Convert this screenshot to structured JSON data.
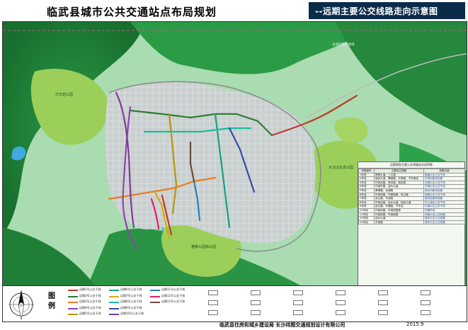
{
  "header": {
    "title": "临武县城市公共交通站点布局规划",
    "subtitle": "--远期主要公交线路走向示意图"
  },
  "map": {
    "labels": {
      "park_west": "万华岩公园",
      "park_east": "大汉山生态公园",
      "park_south": "舂陵公园南公园",
      "road_north": "汝城高速连接线"
    },
    "colors": {
      "forest": "#1f8f3a",
      "park": "#9ccf5a",
      "urban": "#cfd3d3",
      "water": "#3fa9e0"
    }
  },
  "table": {
    "title": "远期规划主要公交线路走向说明表",
    "headers": [
      "线路编号",
      "主要经过道路",
      "线路功能"
    ],
    "rows": [
      {
        "id": "1号线",
        "roads": "舜德大道、三义路",
        "function": "城南片区公交干线"
      },
      {
        "id": "2号线",
        "roads": "临武大道、舜德路、东城路、汽车南站",
        "function": "东西向客流走廊"
      },
      {
        "id": "3号线",
        "roads": "环城北路、滨河路、新区路",
        "function": "北部片区公交干线"
      },
      {
        "id": "4号线",
        "roads": "环城东路、武水大道",
        "function": "东部片区公交干线"
      },
      {
        "id": "5号线",
        "roads": "舜德路、汝城路",
        "function": "南北向客流走廊"
      },
      {
        "id": "6号线",
        "roads": "环城西路、环城南路、官山路",
        "function": "西部片区公交干线"
      },
      {
        "id": "7号线",
        "roads": "官山路、车站路",
        "function": "客运站接驳线路"
      },
      {
        "id": "8号线",
        "roads": "环城北路、武水大道、临武大道",
        "function": "中心城区公交干线"
      },
      {
        "id": "9号线",
        "roads": "官山路、东城路、汽车站",
        "function": "东南片区公交干线"
      },
      {
        "id": "10号线",
        "roads": "环城北路、环城西路等",
        "function": "外围环线"
      },
      {
        "id": "11号线",
        "roads": "环城西路、环城南路",
        "function": "西南片区公交线路"
      },
      {
        "id": "12号线",
        "roads": "武水大道",
        "function": "城东片区公交线路"
      },
      {
        "id": "13号线",
        "roads": "东城路",
        "function": "城东片区公交线路"
      }
    ]
  },
  "legend": {
    "title": "图例",
    "items": [
      {
        "label": "远期1号公交干线",
        "color": "#c0392b"
      },
      {
        "label": "远期2号公交干线",
        "color": "#2e7d32"
      },
      {
        "label": "远期3号公交干线",
        "color": "#e67e22"
      },
      {
        "label": "远期4号公交干线",
        "color": "#8e44ad"
      },
      {
        "label": "远期5号公交干线",
        "color": "#b7950b"
      },
      {
        "label": "远期6号公交干线",
        "color": "#16a085"
      },
      {
        "label": "远期7号公交干线",
        "color": "#d4ac0d"
      },
      {
        "label": "远期8号公交干线",
        "color": "#1abc9c"
      },
      {
        "label": "远期9号公交干线",
        "color": "#3949ab"
      },
      {
        "label": "远期10号公交干线",
        "color": "#7d3c98"
      },
      {
        "label": "远期11号公交干线",
        "color": "#2980b9"
      },
      {
        "label": "远期12号公交干线",
        "color": "#e91e63"
      },
      {
        "label": "远期13号公交干线",
        "color": "#6d4c41"
      }
    ]
  },
  "footer": {
    "company": "临武县住房和城乡建设局  长沙纬图交通规划设计有限公司",
    "date": "2015.9"
  }
}
